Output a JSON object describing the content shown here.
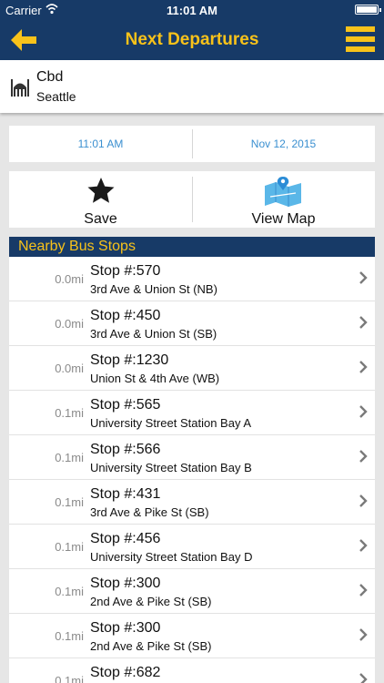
{
  "status": {
    "carrier": "Carrier",
    "time": "11:01 AM"
  },
  "nav": {
    "title": "Next Departures"
  },
  "location": {
    "name": "Cbd",
    "city": "Seattle"
  },
  "datetime": {
    "time": "11:01 AM",
    "date": "Nov 12, 2015"
  },
  "actions": {
    "save_label": "Save",
    "map_label": "View Map"
  },
  "section": {
    "title": "Nearby Bus Stops"
  },
  "stops": [
    {
      "distance": "0.0mi",
      "stop": "Stop #:570",
      "address": "3rd Ave & Union St (NB)"
    },
    {
      "distance": "0.0mi",
      "stop": "Stop #:450",
      "address": "3rd Ave & Union St (SB)"
    },
    {
      "distance": "0.0mi",
      "stop": "Stop #:1230",
      "address": "Union St & 4th Ave (WB)"
    },
    {
      "distance": "0.1mi",
      "stop": "Stop #:565",
      "address": "University Street Station Bay A"
    },
    {
      "distance": "0.1mi",
      "stop": "Stop #:566",
      "address": "University Street Station Bay B"
    },
    {
      "distance": "0.1mi",
      "stop": "Stop #:431",
      "address": "3rd Ave & Pike St (SB)"
    },
    {
      "distance": "0.1mi",
      "stop": "Stop #:456",
      "address": "University Street Station Bay D"
    },
    {
      "distance": "0.1mi",
      "stop": "Stop #:300",
      "address": "2nd Ave & Pike St (SB)"
    },
    {
      "distance": "0.1mi",
      "stop": "Stop #:300",
      "address": "2nd Ave & Pike St (SB)"
    },
    {
      "distance": "0.1mi",
      "stop": "Stop #:682",
      "address": ""
    }
  ],
  "colors": {
    "nav_bg": "#173a67",
    "accent": "#f8c21a",
    "link": "#3a8fd0"
  },
  "icons": {
    "back": "arrow-left-icon",
    "menu": "hamburger-menu-icon",
    "save": "star-icon",
    "map": "map-icon",
    "location": "mosque-icon",
    "chevron": "chevron-right-icon"
  }
}
